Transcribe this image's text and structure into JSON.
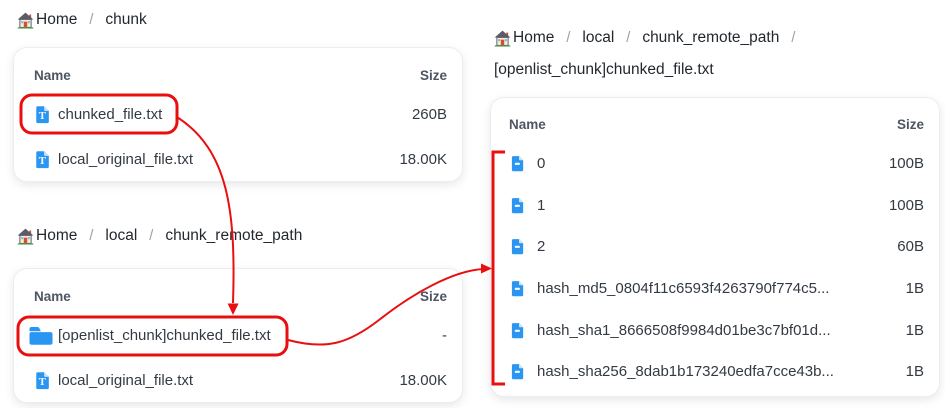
{
  "breadcrumb_separator": "/",
  "colors": {
    "accent_red": "#e90f0f",
    "icon_blue": "#2b96f1",
    "header_text": "#4e5662",
    "row_text": "#333a42"
  },
  "panels": [
    {
      "breadcrumb": {
        "segments": [
          "Home",
          "chunk"
        ]
      },
      "columns": {
        "name": "Name",
        "size": "Size"
      },
      "rows": [
        {
          "icon": "text-file-icon",
          "name": "chunked_file.txt",
          "size": "260B"
        },
        {
          "icon": "text-file-icon",
          "name": "local_original_file.txt",
          "size": "18.00K"
        }
      ]
    },
    {
      "breadcrumb": {
        "segments": [
          "Home",
          "local",
          "chunk_remote_path"
        ]
      },
      "columns": {
        "name": "Name",
        "size": "Size"
      },
      "rows": [
        {
          "icon": "folder-icon",
          "name": "[openlist_chunk]chunked_file.txt",
          "size": "-"
        },
        {
          "icon": "text-file-icon",
          "name": "local_original_file.txt",
          "size": "18.00K"
        }
      ]
    },
    {
      "breadcrumb": {
        "segments": [
          "Home",
          "local",
          "chunk_remote_path",
          "[openlist_chunk]chunked_file.txt"
        ]
      },
      "columns": {
        "name": "Name",
        "size": "Size"
      },
      "rows": [
        {
          "icon": "file-icon",
          "name": "0",
          "size": "100B"
        },
        {
          "icon": "file-icon",
          "name": "1",
          "size": "100B"
        },
        {
          "icon": "file-icon",
          "name": "2",
          "size": "60B"
        },
        {
          "icon": "file-icon",
          "name": "hash_md5_0804f11c6593f4263790f774c5...",
          "size": "1B"
        },
        {
          "icon": "file-icon",
          "name": "hash_sha1_8666508f9984d01be3c7bf01d...",
          "size": "1B"
        },
        {
          "icon": "file-icon",
          "name": "hash_sha256_8dab1b173240edfa7cce43b...",
          "size": "1B"
        }
      ]
    }
  ],
  "annotations": {
    "highlighted_rows": [
      "chunked_file.txt",
      "[openlist_chunk]chunked_file.txt"
    ],
    "arrow_1": "chunked_file.txt -> [openlist_chunk]chunked_file.txt",
    "arrow_2": "[openlist_chunk]chunked_file.txt -> chunk files group",
    "bracket_group": [
      "0",
      "1",
      "2",
      "hash_md5",
      "hash_sha1",
      "hash_sha256"
    ]
  }
}
